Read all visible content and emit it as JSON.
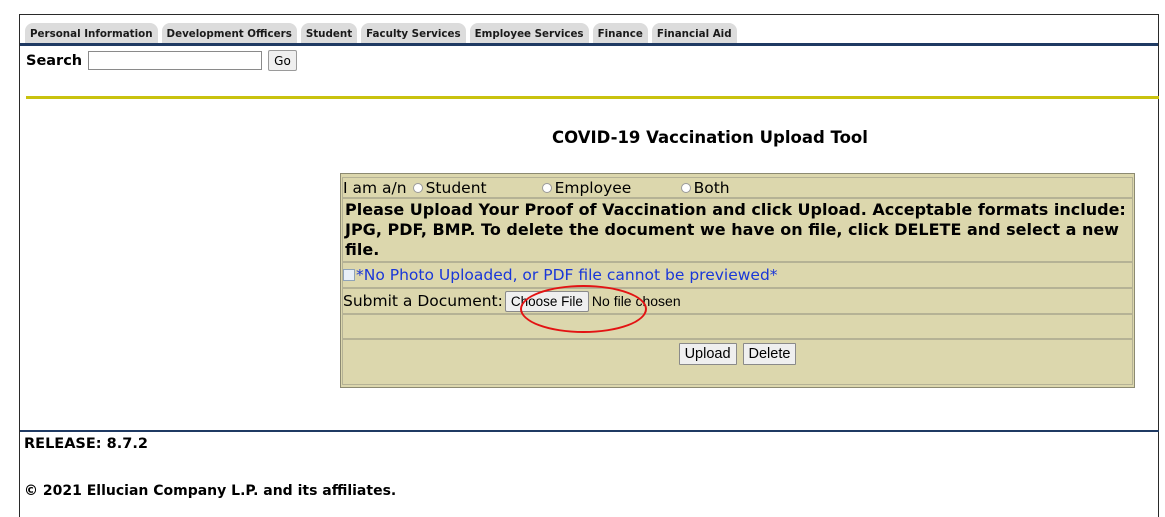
{
  "tabs": [
    "Personal Information",
    "Development Officers",
    "Student",
    "Faculty Services",
    "Employee Services",
    "Finance",
    "Financial Aid"
  ],
  "search": {
    "label": "Search",
    "value": "",
    "button": "Go"
  },
  "page_title": "COVID-19 Vaccination Upload Tool",
  "form": {
    "role_prompt": "I am a/n",
    "role_options": [
      "Student",
      "Employee",
      "Both"
    ],
    "instructions": "Please Upload Your Proof of Vaccination and click Upload. Acceptable formats include: JPG, PDF, BMP. To delete the document we have on file, click DELETE and select a new file.",
    "preview_alt": "*No Photo Uploaded, or PDF file cannot be previewed*",
    "submit_label": "Submit a Document:",
    "choose_file_button": "Choose File",
    "file_status": "No file chosen",
    "upload_button": "Upload",
    "delete_button": "Delete"
  },
  "footer": {
    "release": "RELEASE: 8.7.2",
    "copyright": "© 2021 Ellucian Company L.P. and its affiliates."
  },
  "colors": {
    "tab_bg": "#dcdcdc",
    "nav_line": "#1f3a63",
    "accent_line": "#c9c20e",
    "form_bg": "#dcd7ad",
    "link": "#1a37d8",
    "annotation": "#e31313"
  }
}
